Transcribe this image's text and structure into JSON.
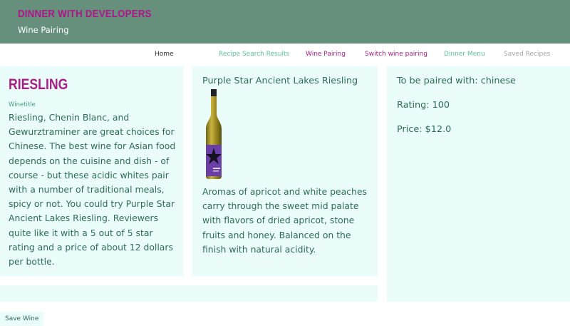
{
  "header": {
    "brand": "DINNER WITH DEVELOPERS",
    "subtitle": "Wine Pairing"
  },
  "nav": {
    "home": "Home",
    "recipe_search_results": "Recipe Search Results",
    "wine_pairing": "Wine Pairing",
    "switch_wine_pairing": "Switch wine pairing",
    "dinner_menu": "Dinner Menu",
    "saved_recipes": "Saved Recipes"
  },
  "wine": {
    "name": "Riesling",
    "caption": "Winetitle",
    "pairing_text": "Riesling, Chenin Blanc, and Gewurztraminer are great choices for Chinese. The best wine for Asian food depends on the cuisine and dish - of course - but these acidic whites pair with a number of traditional meals, spicy or not. You could try Purple Star Ancient Lakes Riesling. Reviewers quite like it with a 5 out of 5 star rating and a price of about 12 dollars per bottle."
  },
  "product": {
    "title": "Purple Star Ancient Lakes Riesling",
    "image_icon": "wine-bottle-image",
    "description": "Aromas of apricot and white peaches carry through the sweet mid palate with flavors of dried apricot, stone fruits and honey. Balanced on the finish with natural acidity."
  },
  "info": {
    "paired_with": "To be paired with: chinese",
    "rating": "Rating: 100",
    "price": "Price: $12.0"
  },
  "actions": {
    "save_wine": "Save Wine"
  },
  "colors": {
    "header_bg": "#66907c",
    "brand": "#b0148a",
    "card_bg": "#ebfdfb",
    "text": "#2d6d54"
  }
}
